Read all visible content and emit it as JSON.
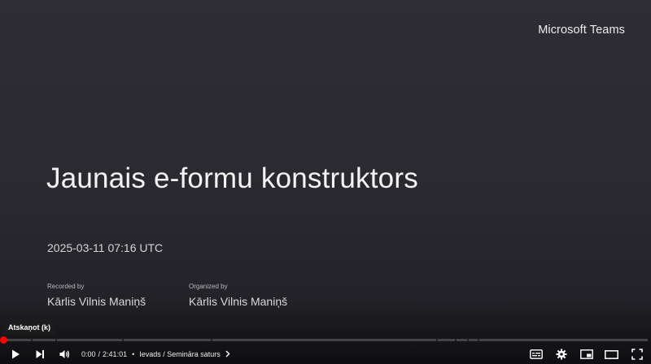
{
  "video": {
    "brand": "Microsoft Teams",
    "title": "Jaunais e-formu konstruktors",
    "date": "2025-03-11 07:16 UTC",
    "recorded_by_label": "Recorded by",
    "recorded_by": "Kārlis Vilnis Maniņš",
    "organized_by_label": "Organized by",
    "organized_by": "Kārlis Vilnis Maniņš"
  },
  "player": {
    "tooltip": "Atskaņot (k)",
    "current_time": "0:00",
    "time_separator": "/",
    "duration": "2:41:01",
    "chapter_separator": "•",
    "chapter": "Ievads / Semināra saturs",
    "progress_fraction": 0.0,
    "icons": {
      "play": "play-icon",
      "next": "next-icon",
      "volume": "volume-icon",
      "subtitles": "subtitles-icon",
      "settings": "gear-icon",
      "miniplayer": "miniplayer-icon",
      "theater": "theater-icon",
      "fullscreen": "fullscreen-icon",
      "chapter": "chevron-right-icon"
    },
    "accent_color": "#ff0000"
  }
}
